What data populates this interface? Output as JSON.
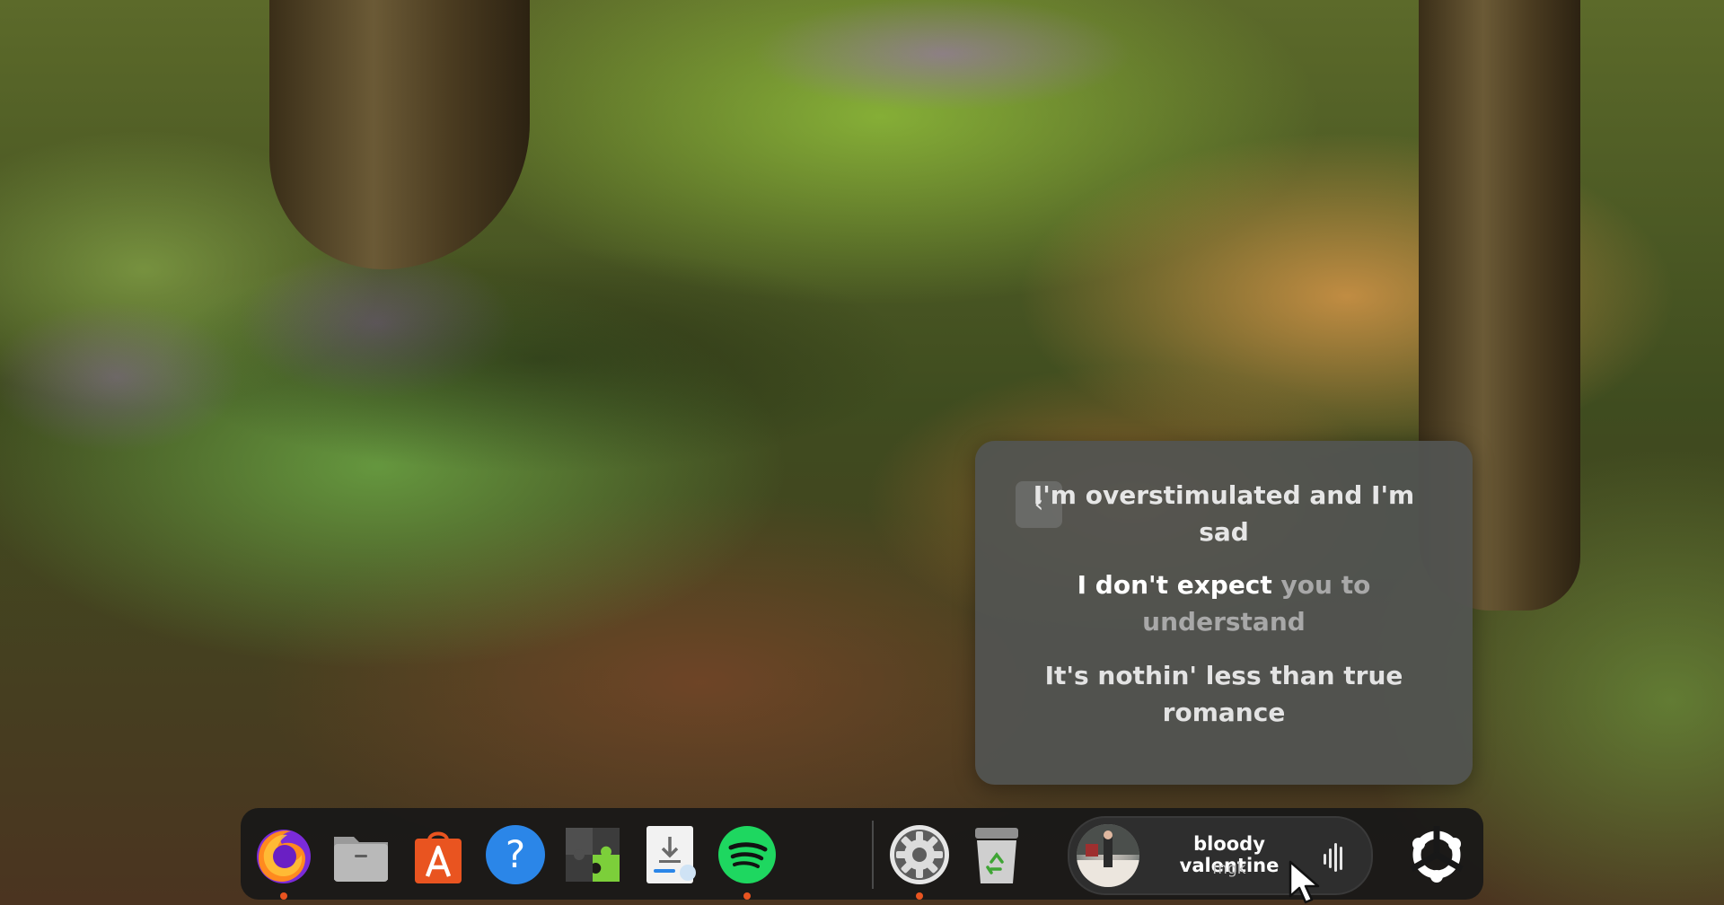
{
  "lyrics": {
    "back_icon": "chevron-left-icon",
    "previous_line": "I'm overstimulated and I'm sad",
    "current_line_sung": "I don't expect",
    "current_line_pending": " you to understand",
    "next_line": "It's nothin' less than true romance"
  },
  "dock": {
    "items": [
      {
        "name": "firefox",
        "icon": "firefox-icon",
        "running": true
      },
      {
        "name": "files",
        "icon": "folder-icon",
        "running": false
      },
      {
        "name": "app-center",
        "icon": "shopping-bag-icon",
        "running": false
      },
      {
        "name": "help",
        "icon": "question-mark-icon",
        "label": "?",
        "running": false
      },
      {
        "name": "extensions",
        "icon": "puzzle-icon",
        "running": false
      },
      {
        "name": "updates",
        "icon": "download-icon",
        "running": false
      },
      {
        "name": "spotify",
        "icon": "spotify-icon",
        "running": true
      },
      {
        "name": "settings",
        "icon": "gear-icon",
        "running": true
      },
      {
        "name": "trash",
        "icon": "trash-icon",
        "running": false
      },
      {
        "name": "show-apps",
        "icon": "ubuntu-logo-icon",
        "running": false
      }
    ],
    "media": {
      "title": "bloody valentine",
      "artist": "mgk",
      "icon": "equalizer-bars-icon"
    }
  },
  "colors": {
    "accent": "#e95420",
    "spotify": "#1ed760",
    "help": "#2b86e8"
  }
}
